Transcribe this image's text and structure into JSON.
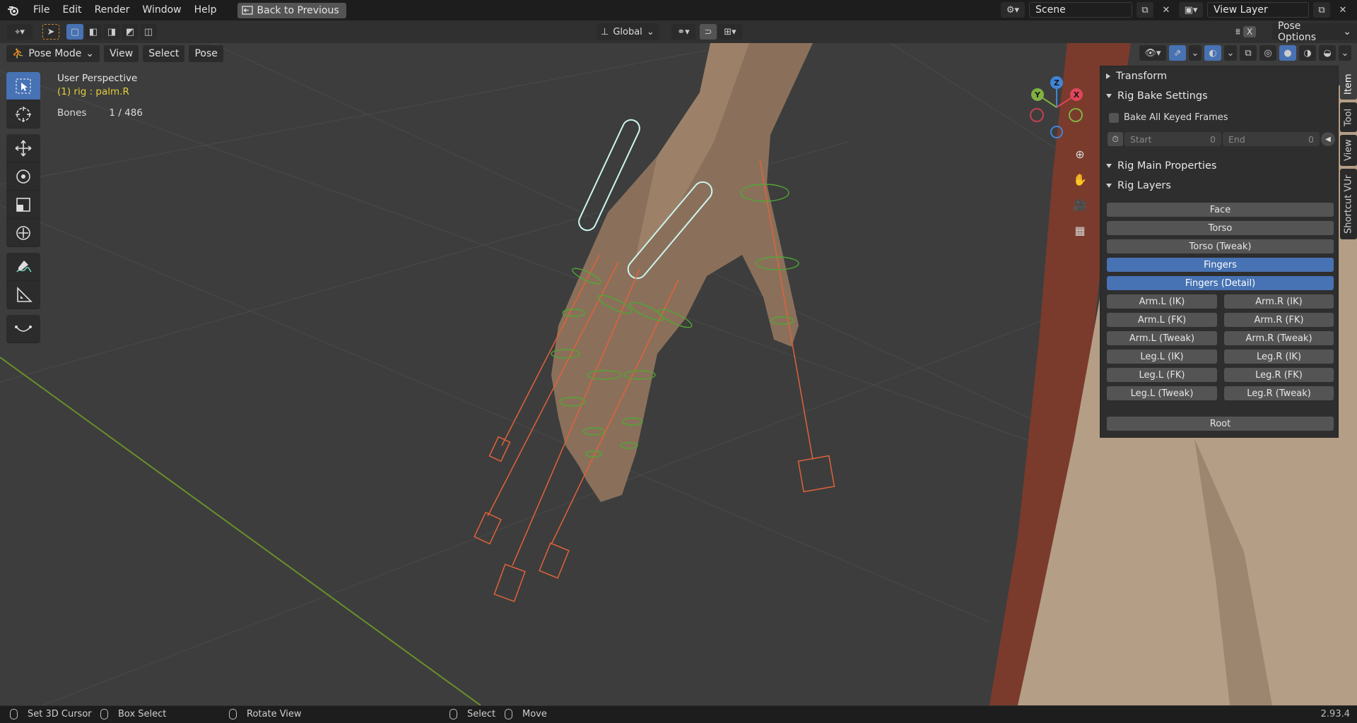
{
  "menu": {
    "items": [
      "File",
      "Edit",
      "Render",
      "Window",
      "Help"
    ],
    "back": "Back to Previous"
  },
  "scene": {
    "label": "Scene",
    "viewlayer": "View Layer"
  },
  "header": {
    "orientation": "Global",
    "pose_options": "Pose Options",
    "x_label": "X",
    "mode": "Pose Mode",
    "menus": [
      "View",
      "Select",
      "Pose"
    ]
  },
  "hud": {
    "perspective": "User Perspective",
    "object": "(1) rig : palm.R",
    "bones_label": "Bones",
    "bones_value": "1 / 486"
  },
  "gizmo": {
    "x": "X",
    "y": "Y",
    "z": "Z"
  },
  "tabs": [
    "Item",
    "Tool",
    "View",
    "Shortcut VUr"
  ],
  "panel": {
    "transform": "Transform",
    "bake": "Rig Bake Settings",
    "bake_all": "Bake All Keyed Frames",
    "start_label": "Start",
    "start_value": "0",
    "end_label": "End",
    "end_value": "0",
    "main_props": "Rig Main Properties",
    "layers_title": "Rig Layers",
    "layers_full": [
      {
        "label": "Face",
        "on": false
      },
      {
        "label": "Torso",
        "on": false
      },
      {
        "label": "Torso (Tweak)",
        "on": false
      },
      {
        "label": "Fingers",
        "on": true
      },
      {
        "label": "Fingers (Detail)",
        "on": true
      }
    ],
    "layers_pairs": [
      [
        "Arm.L (IK)",
        "Arm.R (IK)"
      ],
      [
        "Arm.L (FK)",
        "Arm.R (FK)"
      ],
      [
        "Arm.L (Tweak)",
        "Arm.R (Tweak)"
      ],
      [
        "Leg.L (IK)",
        "Leg.R (IK)"
      ],
      [
        "Leg.L (FK)",
        "Leg.R (FK)"
      ],
      [
        "Leg.L (Tweak)",
        "Leg.R (Tweak)"
      ]
    ],
    "root": "Root"
  },
  "status": {
    "cursor": "Set 3D Cursor",
    "box": "Box Select",
    "rotate": "Rotate View",
    "select": "Select",
    "move": "Move",
    "version": "2.93.4"
  },
  "colors": {
    "accent": "#4772b3",
    "bone": "#e0623a",
    "bone_green": "#5fb33a",
    "active_bone": "#b8f0e6",
    "skin": "#8d7460",
    "axis_x": "#e0455a",
    "axis_y": "#7fb240",
    "axis_z": "#3f86d9"
  }
}
